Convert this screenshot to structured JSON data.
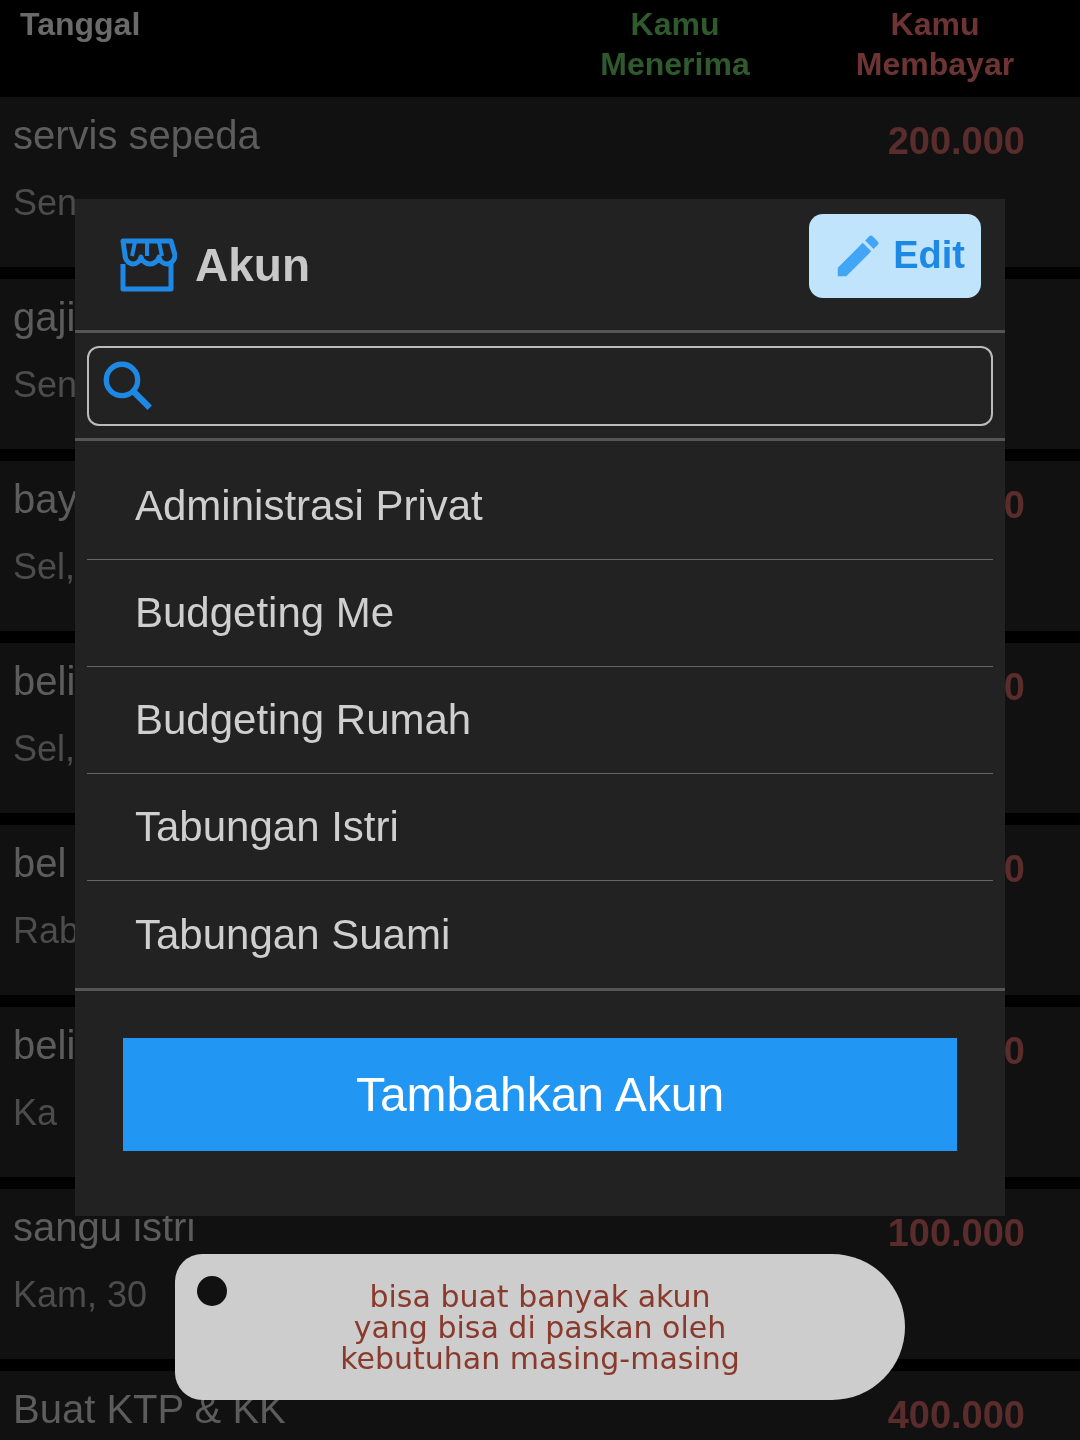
{
  "table": {
    "columns": [
      {
        "label": "Tanggal",
        "kind": "date"
      },
      {
        "label": "Kamu Menerima",
        "kind": "income"
      },
      {
        "label": "Kamu Membayar",
        "kind": "expense"
      }
    ],
    "rows": [
      {
        "title": "servis sepeda",
        "date": "Sen",
        "amount": "200.000"
      },
      {
        "title": "gaji",
        "date": "Sen"
      },
      {
        "title": "bay",
        "date": "Sel,",
        "amount": "0"
      },
      {
        "title": "beli",
        "date": "Sel,",
        "amount": "0"
      },
      {
        "title": "bel",
        "date": "Rab",
        "amount": "0"
      },
      {
        "title": "beli",
        "date": "Ka",
        "amount": "0"
      },
      {
        "title": "sangu istri",
        "date": "Kam, 30",
        "amount": "100.000"
      },
      {
        "title": "Buat KTP & KK",
        "amount": "400.000"
      }
    ]
  },
  "dialog": {
    "title": "Akun",
    "edit_button": "Edit",
    "items": [
      {
        "label": "Administrasi Privat"
      },
      {
        "label": "Budgeting Me"
      },
      {
        "label": "Budgeting Rumah"
      },
      {
        "label": "Tabungan Istri"
      },
      {
        "label": "Tabungan Suami"
      }
    ],
    "add_button": "Tambahkan Akun"
  },
  "callout": {
    "lines": [
      "bisa buat banyak akun",
      "yang bisa di paskan oleh",
      "kebutuhan masing-masing"
    ]
  }
}
